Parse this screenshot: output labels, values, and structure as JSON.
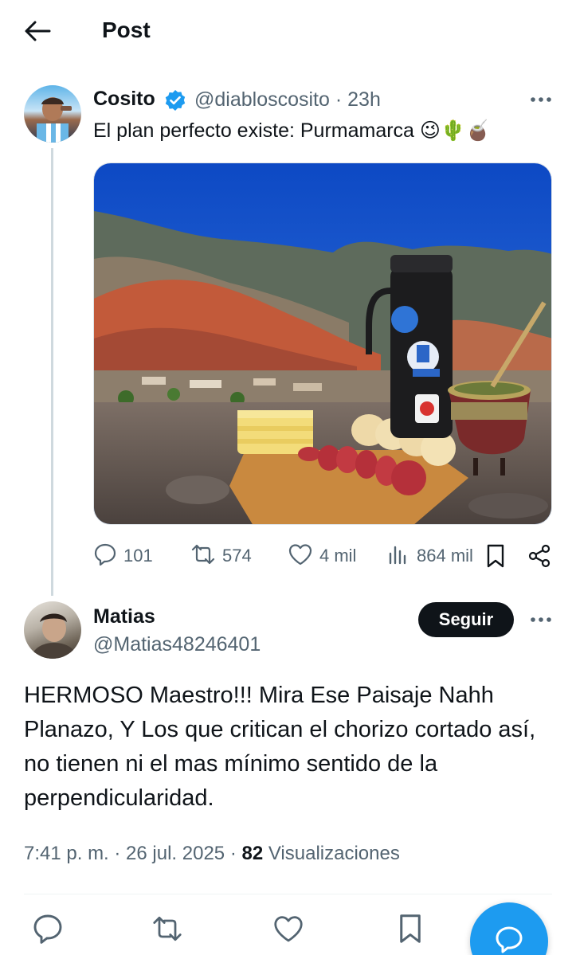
{
  "header": {
    "title": "Post"
  },
  "post": {
    "author_name": "Cosito",
    "author_handle": "@diabloscosito",
    "time": "23h",
    "text": "El plan perfecto existe: Purmamarca 😉🌵🧉",
    "stats": {
      "replies": "101",
      "reposts": "574",
      "likes": "4 mil",
      "views": "864 mil"
    }
  },
  "reply": {
    "author_name": "Matias",
    "author_handle": "@Matias48246401",
    "follow_label": "Seguir",
    "text": "HERMOSO Maestro!!! Mira Ese Paisaje Nahh Planazo, Y Los que critican el chorizo cortado así, no tienen ni el mas mínimo sentido de la perpendicularidad.",
    "timestamp": "7:41 p. m. · 26 jul. 2025 · ",
    "views_count": "82",
    "views_label": "Visualizaciones"
  },
  "icons": {
    "back": "arrow-left-icon",
    "verified": "verified-badge-icon",
    "more": "more-dots-icon",
    "reply": "reply-icon",
    "repost": "repost-icon",
    "like": "heart-icon",
    "views": "views-icon",
    "bookmark": "bookmark-icon",
    "share": "share-icon",
    "compose": "compose-icon"
  },
  "colors": {
    "accent": "#1d9bf0",
    "text": "#0f1419",
    "muted": "#536471"
  }
}
